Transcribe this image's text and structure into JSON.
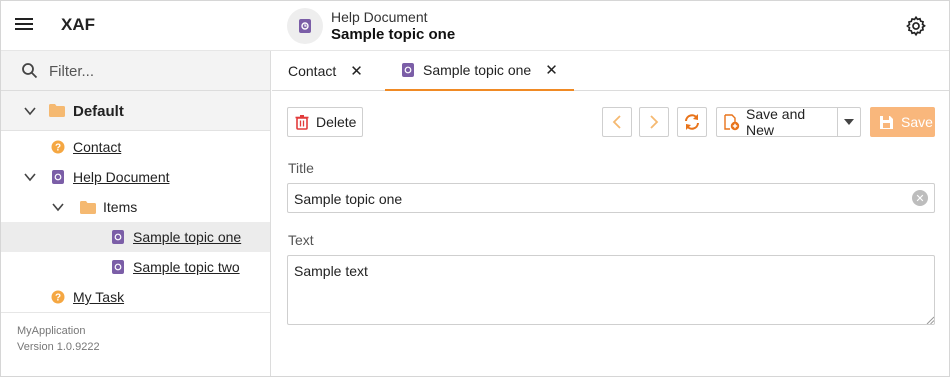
{
  "header": {
    "app_title": "XAF",
    "object_type": "Help Document",
    "object_title": "Sample topic one",
    "menu_icon": "hamburger-menu-icon",
    "settings_icon": "gear-icon"
  },
  "sidebar": {
    "filter_placeholder": "Filter...",
    "group_label": "Default",
    "items": [
      {
        "label": "Contact",
        "icon": "question-icon"
      },
      {
        "label": "Help Document",
        "icon": "document-icon"
      },
      {
        "label": "Items",
        "icon": "folder-icon"
      },
      {
        "label": "Sample topic one",
        "icon": "document-icon",
        "selected": true
      },
      {
        "label": "Sample topic two",
        "icon": "document-icon"
      },
      {
        "label": "My Task",
        "icon": "question-icon"
      }
    ],
    "footer_app": "MyApplication",
    "footer_version": "Version 1.0.9222"
  },
  "tabs": [
    {
      "label": "Contact",
      "active": false
    },
    {
      "label": "Sample topic one",
      "active": true
    }
  ],
  "toolbar": {
    "delete_label": "Delete",
    "save_and_new_label": "Save and New",
    "save_label": "Save"
  },
  "form": {
    "title_label": "Title",
    "title_value": "Sample topic one",
    "text_label": "Text",
    "text_value": "Sample text"
  },
  "colors": {
    "accent": "#f08a24",
    "save_button": "#f9b77c",
    "document_icon": "#7b5ea7",
    "folder_icon": "#f5b971",
    "delete_icon": "#e23b3b"
  }
}
